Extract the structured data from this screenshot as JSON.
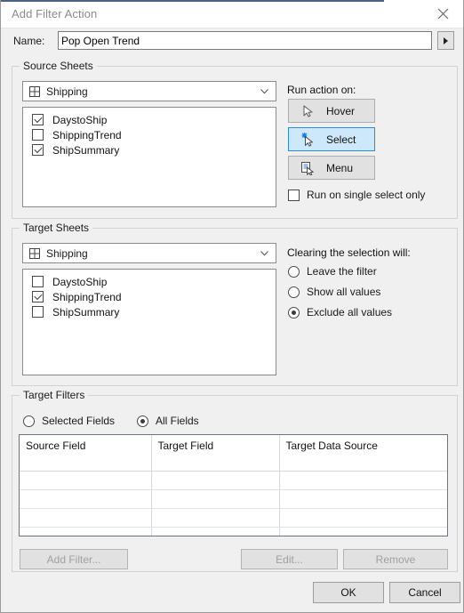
{
  "window": {
    "title": "Add Filter Action",
    "close_icon": "close-icon",
    "accent_color": "#4a6285"
  },
  "name_row": {
    "label": "Name:",
    "value": "Pop Open Trend",
    "placeholder": "",
    "more_button_icon": "triangle-right-icon"
  },
  "source_sheets": {
    "legend": "Source Sheets",
    "dropdown": {
      "icon": "dashboard-grid-icon",
      "value": "Shipping",
      "chevron_icon": "chevron-down-icon"
    },
    "items": [
      {
        "label": "DaystoShip",
        "checked": true
      },
      {
        "label": "ShippingTrend",
        "checked": false
      },
      {
        "label": "ShipSummary",
        "checked": true
      }
    ],
    "run_action_label": "Run action on:",
    "actions": [
      {
        "label": "Hover",
        "icon": "cursor-arrow-icon",
        "selected": false
      },
      {
        "label": "Select",
        "icon": "cursor-sparkle-icon",
        "selected": true
      },
      {
        "label": "Menu",
        "icon": "cursor-menu-page-icon",
        "selected": false
      }
    ],
    "single_select_label": "Run on single select only",
    "single_select_checked": false,
    "selected_color": "#cde8fa",
    "selected_border_color": "#2e8ae0"
  },
  "target_sheets": {
    "legend": "Target Sheets",
    "dropdown": {
      "icon": "dashboard-grid-icon",
      "value": "Shipping",
      "chevron_icon": "chevron-down-icon"
    },
    "items": [
      {
        "label": "DaystoShip",
        "checked": false
      },
      {
        "label": "ShippingTrend",
        "checked": true
      },
      {
        "label": "ShipSummary",
        "checked": false
      }
    ],
    "clearing_label": "Clearing the selection will:",
    "clearing_options": [
      {
        "label": "Leave the filter",
        "selected": false
      },
      {
        "label": "Show all values",
        "selected": false
      },
      {
        "label": "Exclude all values",
        "selected": true
      }
    ]
  },
  "target_filters": {
    "legend": "Target Filters",
    "scope_options": [
      {
        "label": "Selected Fields",
        "selected": false
      },
      {
        "label": "All Fields",
        "selected": true
      }
    ],
    "table": {
      "columns": [
        "Source Field",
        "Target Field",
        "Target Data Source"
      ],
      "rows": [
        [
          "",
          "",
          ""
        ],
        [
          "",
          "",
          ""
        ],
        [
          "",
          "",
          ""
        ],
        [
          "",
          "",
          ""
        ],
        [
          "",
          "",
          ""
        ]
      ]
    },
    "buttons": [
      {
        "label": "Add Filter...",
        "enabled": false
      },
      {
        "label": "Edit...",
        "enabled": false
      },
      {
        "label": "Remove",
        "enabled": false
      }
    ]
  },
  "footer": {
    "ok_label": "OK",
    "cancel_label": "Cancel"
  }
}
